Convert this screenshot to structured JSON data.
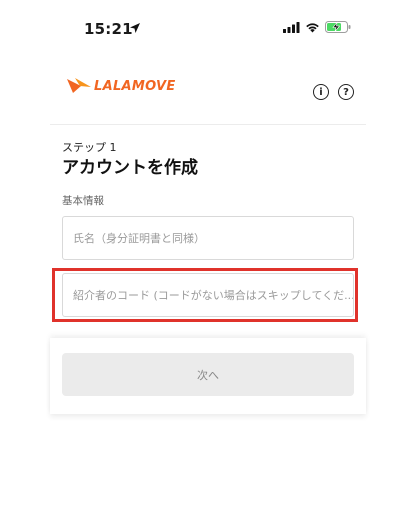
{
  "status_bar": {
    "time": "15:21",
    "icons": [
      "location-arrow-icon",
      "cellular-signal-icon",
      "wifi-icon",
      "battery-charging-icon"
    ]
  },
  "header": {
    "logo_text": "LALAMOVE",
    "info_icon": "info-icon",
    "help_icon": "help-icon",
    "brand_color": "#f16622"
  },
  "form": {
    "step_label": "ステップ 1",
    "title": "アカウントを作成",
    "section_label": "基本情報",
    "name_field": {
      "placeholder": "氏名（身分証明書と同様）",
      "value": ""
    },
    "referral_field": {
      "placeholder": "紹介者のコード (コードがない場合はスキップしてくだ...",
      "value": ""
    }
  },
  "footer": {
    "next_label": "次へ"
  },
  "highlight_color": "#e0322b"
}
